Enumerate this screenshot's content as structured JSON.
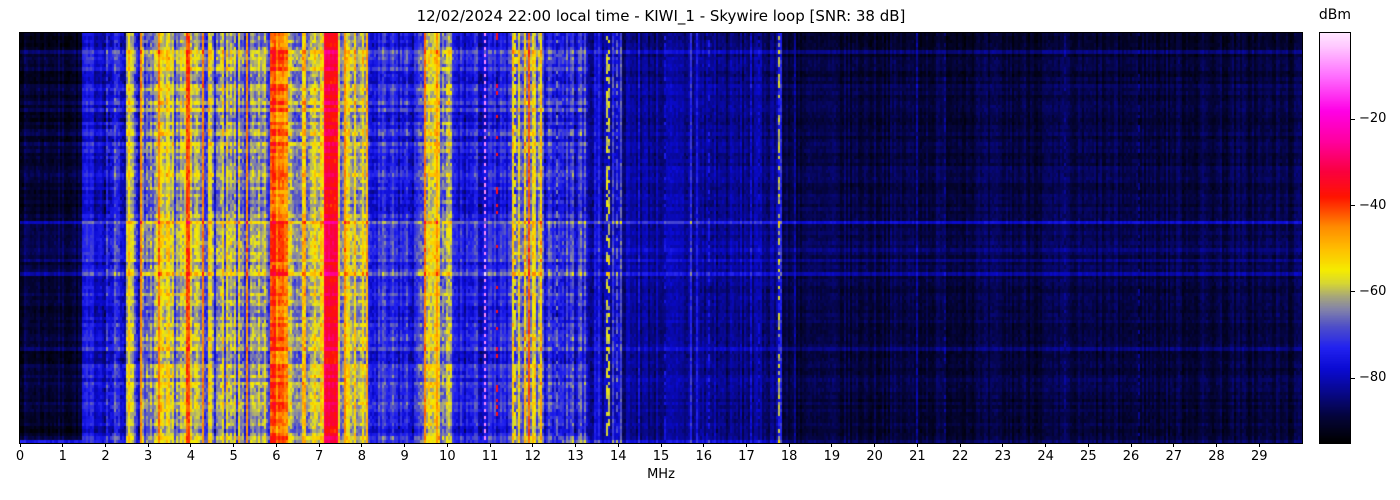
{
  "chart_data": {
    "type": "heatmap",
    "title": "12/02/2024 22:00 local time - KIWI_1 - Skywire loop [SNR: 38 dB]",
    "xlabel": "MHz",
    "station": "KIWI_1",
    "antenna": "Skywire loop",
    "snr_db": 38,
    "timestamp_local": "12/02/2024 22:00",
    "x_range_mhz": [
      0,
      30
    ],
    "x_ticks": [
      "0",
      "1",
      "2",
      "3",
      "4",
      "5",
      "6",
      "7",
      "8",
      "9",
      "10",
      "11",
      "12",
      "13",
      "14",
      "15",
      "16",
      "17",
      "18",
      "19",
      "20",
      "21",
      "22",
      "23",
      "24",
      "25",
      "26",
      "27",
      "28",
      "29"
    ],
    "colorbar": {
      "label": "dBm",
      "range": [
        -95,
        0
      ],
      "ticks": [
        {
          "label": "−20",
          "value": -20
        },
        {
          "label": "−40",
          "value": -40
        },
        {
          "label": "−60",
          "value": -60
        },
        {
          "label": "−80",
          "value": -80
        }
      ],
      "stops": [
        [
          -95,
          "#000000"
        ],
        [
          -89,
          "#04043a"
        ],
        [
          -83,
          "#080890"
        ],
        [
          -78,
          "#0a0ad2"
        ],
        [
          -73,
          "#2222f0"
        ],
        [
          -68,
          "#5050c8"
        ],
        [
          -64,
          "#8484a8"
        ],
        [
          -61,
          "#a8a878"
        ],
        [
          -58,
          "#d7d732"
        ],
        [
          -55,
          "#f5ec00"
        ],
        [
          -50,
          "#ffbe00"
        ],
        [
          -45,
          "#ff8c00"
        ],
        [
          -41,
          "#ff4600"
        ],
        [
          -38,
          "#ff1400"
        ],
        [
          -32,
          "#fa0040"
        ],
        [
          -25,
          "#ff00a0"
        ],
        [
          -18,
          "#ff00e6"
        ],
        [
          -10,
          "#ff6eff"
        ],
        [
          -3,
          "#ffc8ff"
        ],
        [
          0,
          "#ffe6ff"
        ]
      ]
    },
    "grid": {
      "cols": 641,
      "rows": 120
    },
    "seed": 7,
    "busy_region_mhz": [
      0,
      13.3
    ],
    "spectrum_bands": [
      {
        "f": [
          0.0,
          1.45
        ],
        "level": -91,
        "var": 3
      },
      {
        "f": [
          1.45,
          1.95
        ],
        "level": -77,
        "var": 5
      },
      {
        "f": [
          1.95,
          2.5
        ],
        "level": -76,
        "var": 10
      },
      {
        "f": [
          2.5,
          2.65
        ],
        "level": -57,
        "var": 6
      },
      {
        "f": [
          2.65,
          3.1
        ],
        "level": -71,
        "var": 12
      },
      {
        "f": [
          3.1,
          4.5
        ],
        "level": -62,
        "var": 10
      },
      {
        "f": [
          4.5,
          5.35
        ],
        "level": -66,
        "var": 12
      },
      {
        "f": [
          5.35,
          5.85
        ],
        "level": -67,
        "var": 10
      },
      {
        "f": [
          5.85,
          6.25
        ],
        "level": -43,
        "var": 6
      },
      {
        "f": [
          6.25,
          7.1
        ],
        "level": -58,
        "var": 10
      },
      {
        "f": [
          7.1,
          7.42
        ],
        "level": -34,
        "var": 4
      },
      {
        "f": [
          7.42,
          8.15
        ],
        "level": -60,
        "var": 10
      },
      {
        "f": [
          8.15,
          9.35
        ],
        "level": -75,
        "var": 8
      },
      {
        "f": [
          9.35,
          10.1
        ],
        "level": -64,
        "var": 12
      },
      {
        "f": [
          10.1,
          11.5
        ],
        "level": -76,
        "var": 7
      },
      {
        "f": [
          11.5,
          12.25
        ],
        "level": -60,
        "var": 11
      },
      {
        "f": [
          12.25,
          13.25
        ],
        "level": -73,
        "var": 9
      },
      {
        "f": [
          13.25,
          13.85
        ],
        "level": -80,
        "var": 6
      },
      {
        "f": [
          13.85,
          14.1
        ],
        "level": -74,
        "var": 9
      },
      {
        "f": [
          14.1,
          15.6
        ],
        "level": -84,
        "var": 4
      },
      {
        "f": [
          15.6,
          16.4
        ],
        "level": -83,
        "var": 5
      },
      {
        "f": [
          16.4,
          17.7
        ],
        "level": -85,
        "var": 4
      },
      {
        "f": [
          17.7,
          17.85
        ],
        "level": -75,
        "var": 8
      },
      {
        "f": [
          17.85,
          30.0
        ],
        "level": -90,
        "var": 3
      }
    ],
    "carrier_lines": [
      {
        "f": 2.85,
        "w": 0.05,
        "level": -46,
        "style": "solid"
      },
      {
        "f": 3.25,
        "w": 0.06,
        "level": -44,
        "style": "solid"
      },
      {
        "f": 3.95,
        "w": 0.09,
        "level": -41,
        "style": "solid"
      },
      {
        "f": 4.27,
        "w": 0.05,
        "level": -45,
        "style": "solid"
      },
      {
        "f": 5.32,
        "w": 0.05,
        "level": -46,
        "style": "solid"
      },
      {
        "f": 7.62,
        "w": 0.05,
        "level": -46,
        "style": "solid"
      },
      {
        "f": 8.12,
        "w": 0.05,
        "level": -50,
        "style": "solid"
      },
      {
        "f": 9.47,
        "w": 0.06,
        "level": -44,
        "style": "solid"
      },
      {
        "f": 9.77,
        "w": 0.05,
        "level": -47,
        "style": "solid"
      },
      {
        "f": 10.9,
        "w": 0.05,
        "level": -8,
        "style": "dotted"
      },
      {
        "f": 11.17,
        "w": 0.05,
        "level": -36,
        "style": "sparse"
      },
      {
        "f": 11.6,
        "w": 0.05,
        "level": -55,
        "style": "dashed"
      },
      {
        "f": 11.9,
        "w": 0.06,
        "level": -42,
        "style": "solid"
      },
      {
        "f": 12.55,
        "w": 0.05,
        "level": -66,
        "style": "dashed"
      },
      {
        "f": 13.1,
        "w": 0.05,
        "level": -74,
        "style": "solid"
      },
      {
        "f": 13.56,
        "w": 0.05,
        "level": -73,
        "style": "solid"
      },
      {
        "f": 13.75,
        "w": 0.07,
        "level": -58,
        "style": "dashed"
      },
      {
        "f": 13.97,
        "w": 0.06,
        "level": -68,
        "style": "dashed"
      },
      {
        "f": 14.5,
        "w": 0.05,
        "level": -77,
        "style": "solid"
      },
      {
        "f": 15.1,
        "w": 0.05,
        "level": -77,
        "style": "dashed"
      },
      {
        "f": 15.72,
        "w": 0.05,
        "level": -72,
        "style": "solid"
      },
      {
        "f": 15.85,
        "w": 0.05,
        "level": -75,
        "style": "solid"
      },
      {
        "f": 16.12,
        "w": 0.05,
        "level": -76,
        "style": "dashed"
      },
      {
        "f": 17.12,
        "w": 0.04,
        "level": -78,
        "style": "solid"
      },
      {
        "f": 17.3,
        "w": 0.04,
        "level": -79,
        "style": "dashed"
      },
      {
        "f": 17.78,
        "w": 0.05,
        "level": -60,
        "style": "dashed"
      },
      {
        "f": 18.12,
        "w": 0.04,
        "level": -82,
        "style": "solid"
      },
      {
        "f": 21.0,
        "w": 0.04,
        "level": -83,
        "style": "solid"
      },
      {
        "f": 21.65,
        "w": 0.04,
        "level": -84,
        "style": "dashed"
      },
      {
        "f": 24.45,
        "w": 0.04,
        "level": -85,
        "style": "solid"
      },
      {
        "f": 26.2,
        "w": 0.04,
        "level": -85,
        "style": "dashed"
      }
    ],
    "time_row_events": [
      {
        "y": 0.046,
        "boost": 4
      },
      {
        "y": 0.125,
        "boost": 3
      },
      {
        "y": 0.46,
        "boost": 11
      },
      {
        "y": 0.53,
        "boost": 5
      },
      {
        "y": 0.557,
        "boost": 4
      },
      {
        "y": 0.585,
        "boost": 7
      },
      {
        "y": 0.775,
        "boost": 3
      },
      {
        "y": 0.845,
        "boost": 3
      }
    ],
    "bottom_row": {
      "level": -75,
      "f_strong_end": 12.7,
      "f_mid_end": 18,
      "mid_boost": 6,
      "tail_boost": 3
    }
  }
}
